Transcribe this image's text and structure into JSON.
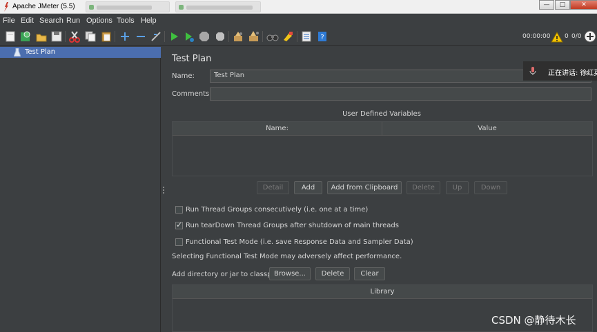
{
  "window": {
    "title": "Apache JMeter (5.5)",
    "minimize": "—",
    "maximize": "□",
    "close": "✕"
  },
  "menu": [
    "File",
    "Edit",
    "Search",
    "Run",
    "Options",
    "Tools",
    "Help"
  ],
  "toolbar": {
    "icons": [
      "new-icon",
      "templates-icon",
      "open-icon",
      "save-icon",
      "cut-icon",
      "copy-icon",
      "paste-icon",
      "expand-icon",
      "collapse-icon",
      "toggle-icon",
      "start-icon",
      "start-no-pauses-icon",
      "stop-icon",
      "shutdown-icon",
      "clear-icon",
      "clear-all-icon",
      "search-icon",
      "reset-search-icon",
      "function-helper-icon",
      "help-icon"
    ],
    "timer": "00:00:00",
    "error_count": "0",
    "threads": "0/0"
  },
  "tree": {
    "items": [
      {
        "label": "Test Plan"
      }
    ]
  },
  "test_plan": {
    "heading": "Test Plan",
    "name_label": "Name:",
    "name_value": "Test Plan",
    "comments_label": "Comments:",
    "comments_value": "",
    "variables_title": "User Defined Variables",
    "variables_columns": [
      "Name:",
      "Value"
    ],
    "variables_buttons": [
      {
        "label": "Detail",
        "enabled": false
      },
      {
        "label": "Add",
        "enabled": true
      },
      {
        "label": "Add from Clipboard",
        "enabled": true
      },
      {
        "label": "Delete",
        "enabled": false
      },
      {
        "label": "Up",
        "enabled": false
      },
      {
        "label": "Down",
        "enabled": false
      }
    ],
    "options": [
      {
        "label": "Run Thread Groups consecutively (i.e. one at a time)",
        "checked": false
      },
      {
        "label": "Run tearDown Thread Groups after shutdown of main threads",
        "checked": true
      },
      {
        "label": "Functional Test Mode (i.e. save Response Data and Sampler Data)",
        "checked": false
      }
    ],
    "functional_note": "Selecting Functional Test Mode may adversely affect performance.",
    "classpath_label": "Add directory or jar to classpath",
    "classpath_buttons": [
      "Browse...",
      "Delete",
      "Clear"
    ],
    "library_column": "Library"
  },
  "overlay": {
    "speaking_text": "正在讲话: 徐红英",
    "watermark": "CSDN @静待木长"
  },
  "colors": {
    "background": "#3c3f41",
    "selection": "#4b6eaf",
    "field": "#45494a"
  }
}
